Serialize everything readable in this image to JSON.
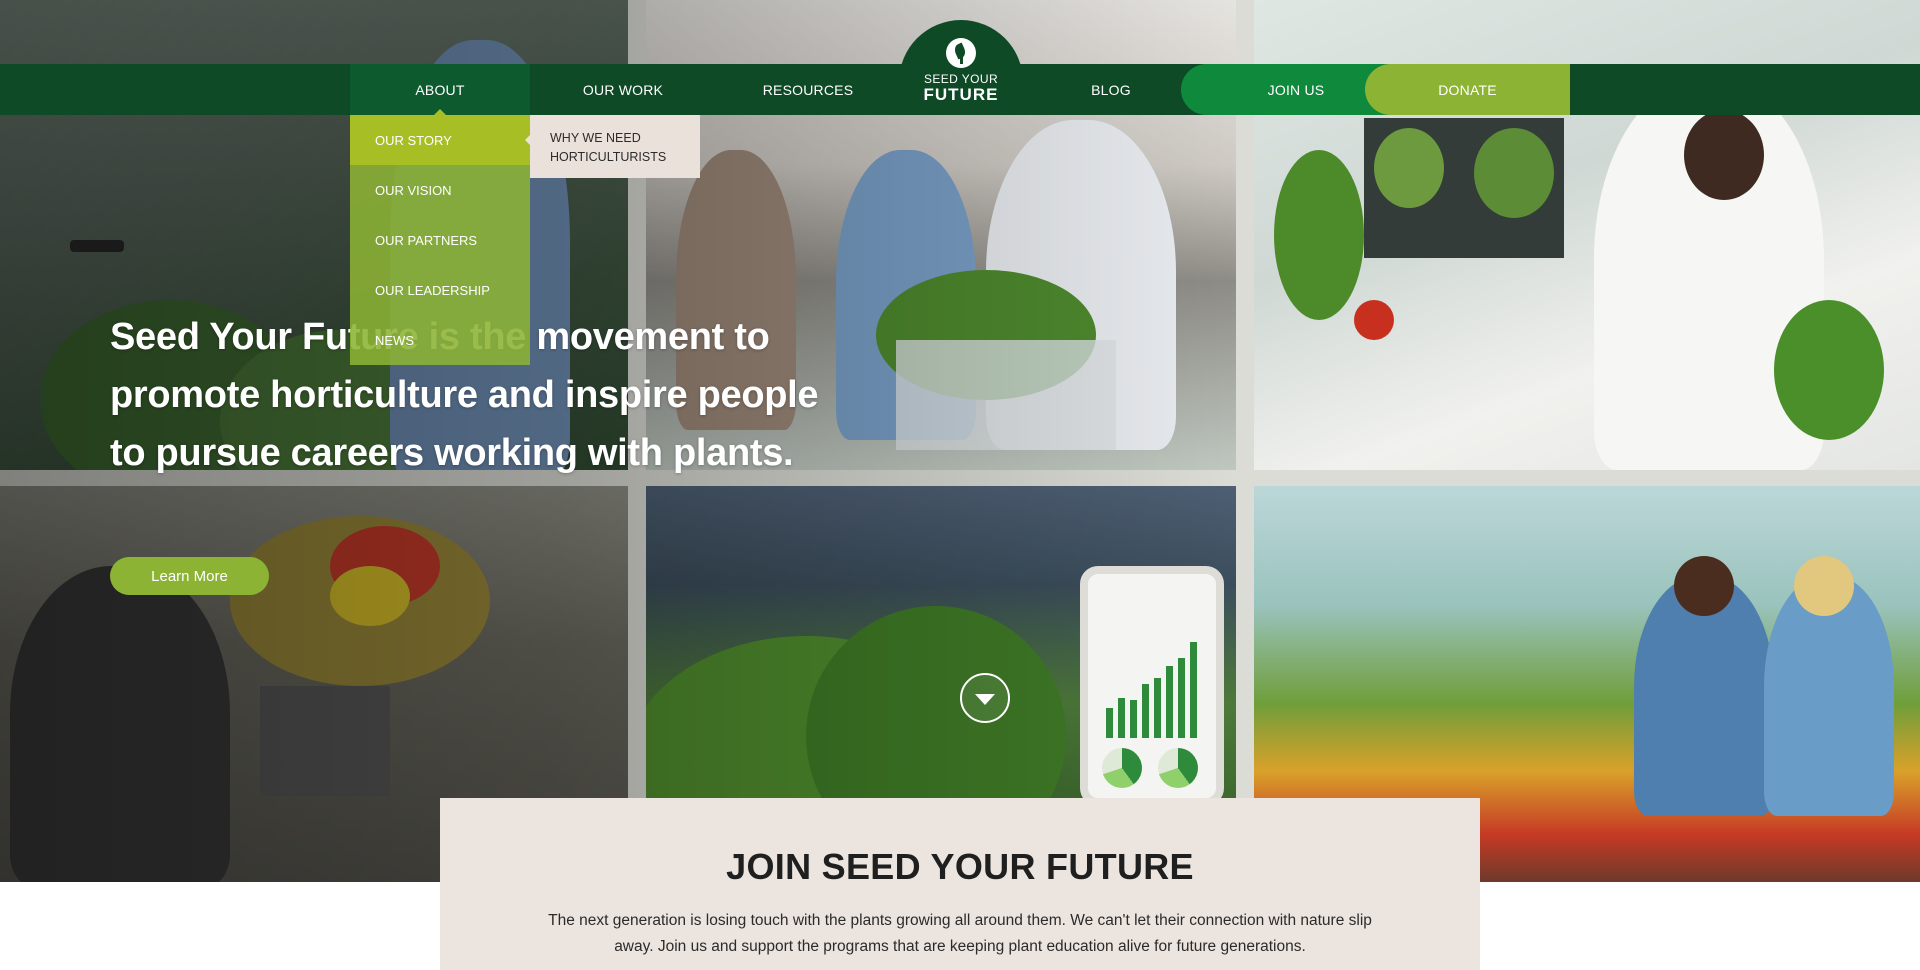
{
  "nav": {
    "about": "ABOUT",
    "our_work": "OUR WORK",
    "resources": "RESOURCES",
    "blog": "BLOG",
    "join_us": "JOIN US",
    "donate": "DONATE"
  },
  "logo": {
    "line1": "SEED YOUR",
    "line2": "FUTURE"
  },
  "about_menu": {
    "items": [
      "OUR STORY",
      "OUR VISION",
      "OUR PARTNERS",
      "OUR LEADERSHIP",
      "NEWS"
    ],
    "active_index": 0,
    "submenu": "WHY WE NEED HORTICULTURISTS"
  },
  "hero": {
    "heading": "Seed Your Future is the movement to promote horticulture and inspire people to pursue careers working with plants.",
    "cta": "Learn More",
    "scroll_icon": "chevron-down-icon"
  },
  "join": {
    "title": "JOIN SEED YOUR FUTURE",
    "body": "The next generation is losing touch with the plants growing all around them. We can't let their connection with nature slip away. Join us and support the programs that are keeping plant education alive for future generations."
  },
  "colors": {
    "nav_dark_green": "#0e4a26",
    "join_green": "#0f8a3c",
    "lime": "#8cb334",
    "lime_active": "#a7bf24",
    "beige": "#ebe4df"
  }
}
